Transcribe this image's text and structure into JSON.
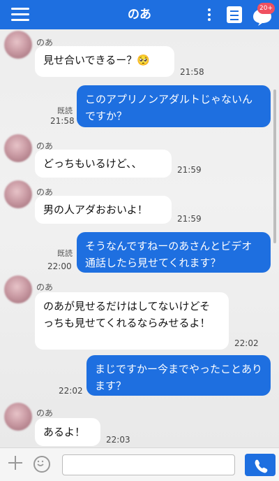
{
  "header": {
    "title": "のあ",
    "badge": "20+",
    "menu_icon": "hamburger-icon",
    "more_icon": "kebab-icon",
    "note_icon": "document-icon",
    "chat_icon": "chat-bubble-icon",
    "accent": "#1e6fe0",
    "badge_color": "#f05060"
  },
  "messages": [
    {
      "from": "in",
      "name": "のあ",
      "text": "見せ合いできるー？🥺",
      "time": "21:58"
    },
    {
      "from": "out",
      "read": "既読",
      "text": "このアプリノンアダルトじゃないんですか？",
      "time": "21:58"
    },
    {
      "from": "in",
      "name": "のあ",
      "text": "どっちもいるけど、、",
      "time": "21:59"
    },
    {
      "from": "in",
      "name": "のあ",
      "text": "男の人アダおおいよ！",
      "time": "21:59"
    },
    {
      "from": "out",
      "read": "既読",
      "text": "そうなんですねーのあさんとビデオ通話したら見せてくれます？",
      "time": "22:00"
    },
    {
      "from": "in",
      "name": "のあ",
      "text": "のあが見せるだけはしてないけどそっちも見せてくれるならみせるよ！",
      "time": "22:02"
    },
    {
      "from": "out",
      "read": "",
      "text": "まじですかー今までやったことあります？",
      "time": "22:02"
    },
    {
      "from": "in",
      "name": "のあ",
      "text": "あるよ！",
      "time": "22:03"
    }
  ],
  "composer": {
    "placeholder": "",
    "plus_icon": "plus-icon",
    "emoji_icon": "smiley-icon",
    "call_icon": "phone-icon"
  }
}
